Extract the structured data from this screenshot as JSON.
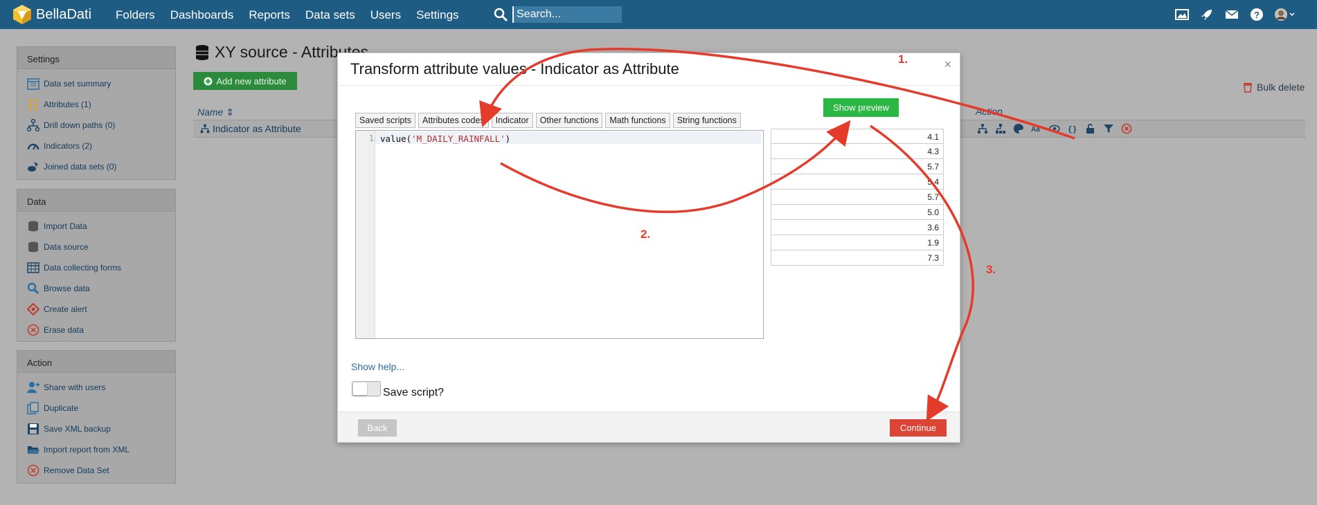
{
  "app": {
    "name": "BellaDati",
    "nav": [
      "Folders",
      "Dashboards",
      "Reports",
      "Data sets",
      "Users",
      "Settings"
    ],
    "search_placeholder": "Search..."
  },
  "topicons": [
    "image-icon",
    "rocket-icon",
    "mail-icon",
    "help-icon",
    "avatar"
  ],
  "sidebar": {
    "settings": {
      "title": "Settings",
      "items": [
        {
          "label": "Data set summary",
          "icon": "calendar-icon"
        },
        {
          "label": "Attributes (1)",
          "icon": "attributes-icon"
        },
        {
          "label": "Drill down paths (0)",
          "icon": "hierarchy-icon"
        },
        {
          "label": "Indicators (2)",
          "icon": "gauge-icon"
        },
        {
          "label": "Joined data sets (0)",
          "icon": "join-icon"
        }
      ]
    },
    "data": {
      "title": "Data",
      "items": [
        {
          "label": "Import Data",
          "icon": "database-icon"
        },
        {
          "label": "Data source",
          "icon": "database-icon"
        },
        {
          "label": "Data collecting forms",
          "icon": "table-icon"
        },
        {
          "label": "Browse data",
          "icon": "search-icon"
        },
        {
          "label": "Create alert",
          "icon": "alert-icon"
        },
        {
          "label": "Erase data",
          "icon": "erase-icon"
        }
      ]
    },
    "action": {
      "title": "Action",
      "items": [
        {
          "label": "Share with users",
          "icon": "user-add-icon"
        },
        {
          "label": "Duplicate",
          "icon": "duplicate-icon"
        },
        {
          "label": "Save XML backup",
          "icon": "save-icon"
        },
        {
          "label": "Import report from XML",
          "icon": "folder-open-icon"
        },
        {
          "label": "Remove Data Set",
          "icon": "remove-icon"
        }
      ]
    }
  },
  "main": {
    "title": "XY source - Attributes",
    "add_attribute": "Add new attribute",
    "bulk_delete": "Bulk delete",
    "col_name": "Name",
    "col_action": "Action",
    "row_name": "Indicator as Attribute"
  },
  "modal": {
    "title": "Transform attribute values - Indicator as Attribute",
    "close": "×",
    "tabs": [
      "Saved scripts",
      "Attributes codes",
      "Indicator",
      "Other functions",
      "Math functions",
      "String functions"
    ],
    "line_number": "1",
    "code_fn": "value(",
    "code_str": "'M_DAILY_RAINFALL'",
    "code_end": ")",
    "show_preview": "Show preview",
    "preview_values": [
      "4.1",
      "4.3",
      "5.7",
      "5.4",
      "5.7",
      "5.0",
      "3.6",
      "1.9",
      "7.3"
    ],
    "show_help": "Show help...",
    "save_script": "Save script?",
    "back": "Back",
    "continue": "Continue"
  },
  "annotations": {
    "step1": "1.",
    "step2": "2.",
    "step3": "3.",
    "color": "#e53b2a"
  }
}
